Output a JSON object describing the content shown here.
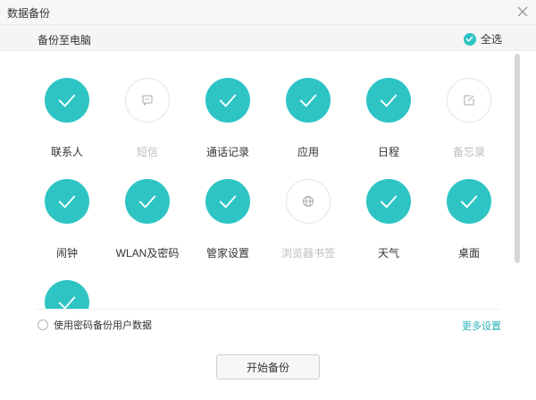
{
  "window": {
    "title": "数据备份"
  },
  "subheader": {
    "title": "备份至电脑",
    "select_all_label": "全选"
  },
  "items": [
    {
      "label": "联系人",
      "checked": true,
      "icon": "check-icon"
    },
    {
      "label": "短信",
      "checked": false,
      "icon": "message-bubble-icon"
    },
    {
      "label": "通话记录",
      "checked": true,
      "icon": "check-icon"
    },
    {
      "label": "应用",
      "checked": true,
      "icon": "check-icon"
    },
    {
      "label": "日程",
      "checked": true,
      "icon": "check-icon"
    },
    {
      "label": "备忘录",
      "checked": false,
      "icon": "note-edit-icon"
    },
    {
      "label": "闹钟",
      "checked": true,
      "icon": "check-icon"
    },
    {
      "label": "WLAN及密码",
      "checked": true,
      "icon": "check-icon"
    },
    {
      "label": "管家设置",
      "checked": true,
      "icon": "check-icon"
    },
    {
      "label": "浏览器书签",
      "checked": false,
      "icon": "globe-icon"
    },
    {
      "label": "天气",
      "checked": true,
      "icon": "check-icon"
    },
    {
      "label": "桌面",
      "checked": true,
      "icon": "check-icon"
    },
    {
      "label": "",
      "checked": true,
      "icon": "check-icon"
    }
  ],
  "footer": {
    "password_option_label": "使用密码备份用户数据",
    "more_settings_label": "更多设置",
    "start_button_label": "开始备份"
  },
  "colors": {
    "accent": "#2ec4c4",
    "muted_text": "#bdbdbd",
    "link": "#2ab3b8"
  }
}
